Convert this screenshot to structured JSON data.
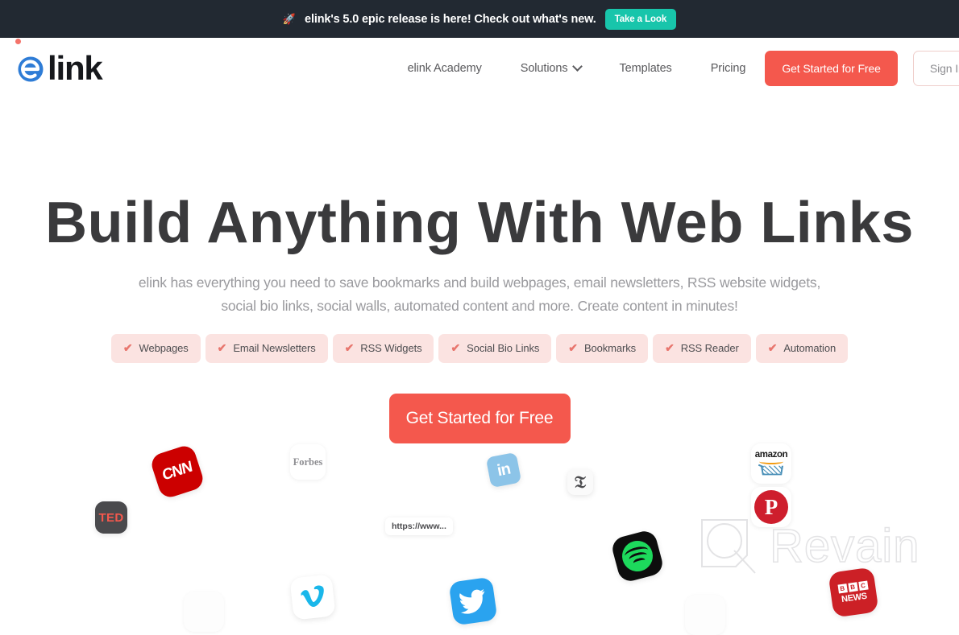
{
  "announcement": {
    "icon": "rocket-icon",
    "glyph": "🚀",
    "text": "elink's 5.0 epic release is here! Check out what's new.",
    "button_label": "Take a Look",
    "bg_color": "#222932",
    "button_color": "#18C5AB"
  },
  "header": {
    "logo": {
      "mark": "e",
      "word": "link",
      "mark_color": "#2E7CD6",
      "dot_color": "#F4736A"
    },
    "nav": [
      {
        "label": "elink Academy",
        "has_dropdown": false
      },
      {
        "label": "Solutions",
        "has_dropdown": true
      },
      {
        "label": "Templates",
        "has_dropdown": false
      },
      {
        "label": "Pricing",
        "has_dropdown": false
      }
    ],
    "primary_button": "Get Started for Free",
    "secondary_button": "Sign In",
    "accent_color": "#F4584D"
  },
  "hero": {
    "title": "Build Anything With Web Links",
    "subtitle": "elink has everything you need to save bookmarks and build webpages, email newsletters, RSS website widgets, social bio links, social walls, automated content and more. Create content in minutes!",
    "features": [
      "Webpages",
      "Email Newsletters",
      "RSS Widgets",
      "Social Bio Links",
      "Bookmarks",
      "RSS Reader",
      "Automation"
    ],
    "check_glyph": "✔",
    "cta_label": "Get Started for Free",
    "pill_bg": "#FBE3E1",
    "pill_check_color": "#E8766E"
  },
  "brand_logos": [
    {
      "id": "ted",
      "name": "TED",
      "label": "TED"
    },
    {
      "id": "cnn",
      "name": "CNN",
      "label": "CNN"
    },
    {
      "id": "forbes",
      "name": "Forbes",
      "label": "Forbes"
    },
    {
      "id": "url",
      "name": "URL chip",
      "label": "https://www..."
    },
    {
      "id": "vimeo",
      "name": "Vimeo",
      "label": "V"
    },
    {
      "id": "twitter",
      "name": "Twitter",
      "label": "🐦"
    },
    {
      "id": "linkedin",
      "name": "LinkedIn",
      "label": "in"
    },
    {
      "id": "nyt",
      "name": "The New York Times",
      "label": "𝔗"
    },
    {
      "id": "spotify",
      "name": "Spotify",
      "label": ""
    },
    {
      "id": "amazon",
      "name": "Amazon",
      "label": "amazon"
    },
    {
      "id": "pinterest",
      "name": "Pinterest",
      "label": "P"
    },
    {
      "id": "revain",
      "name": "Revain",
      "label": "Revain"
    },
    {
      "id": "bbc",
      "name": "BBC News",
      "label": "NEWS",
      "blocks": [
        "B",
        "B",
        "C"
      ]
    }
  ]
}
